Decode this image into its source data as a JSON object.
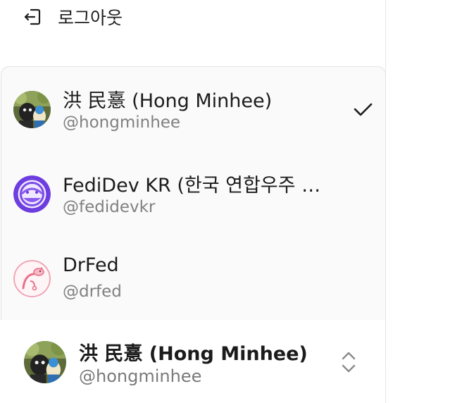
{
  "logout": {
    "label": "로그아웃",
    "icon": "logout-icon"
  },
  "switcher": {
    "accounts": [
      {
        "name": "洪 民憙 (Hong Minhee)",
        "handle": "@hongminhee",
        "selected": true,
        "avatar": "photo-avatar"
      },
      {
        "name": "FediDev KR (한국 연합우주 개발자 모임)",
        "handle": "@fedidevkr",
        "selected": false,
        "avatar": "fedidev-logo-avatar"
      },
      {
        "name": "DrFed",
        "handle": "@drfed",
        "selected": false,
        "avatar": "drfed-logo-avatar"
      }
    ],
    "check_icon": "check-icon"
  },
  "current": {
    "name": "洪 民憙 (Hong Minhee)",
    "handle": "@hongminhee",
    "icon": "chevron-up-down-icon"
  },
  "colors": {
    "accent": "#6d3de0",
    "muted": "#808080",
    "surface": "#fafafa",
    "border": "#e3e3e3"
  }
}
